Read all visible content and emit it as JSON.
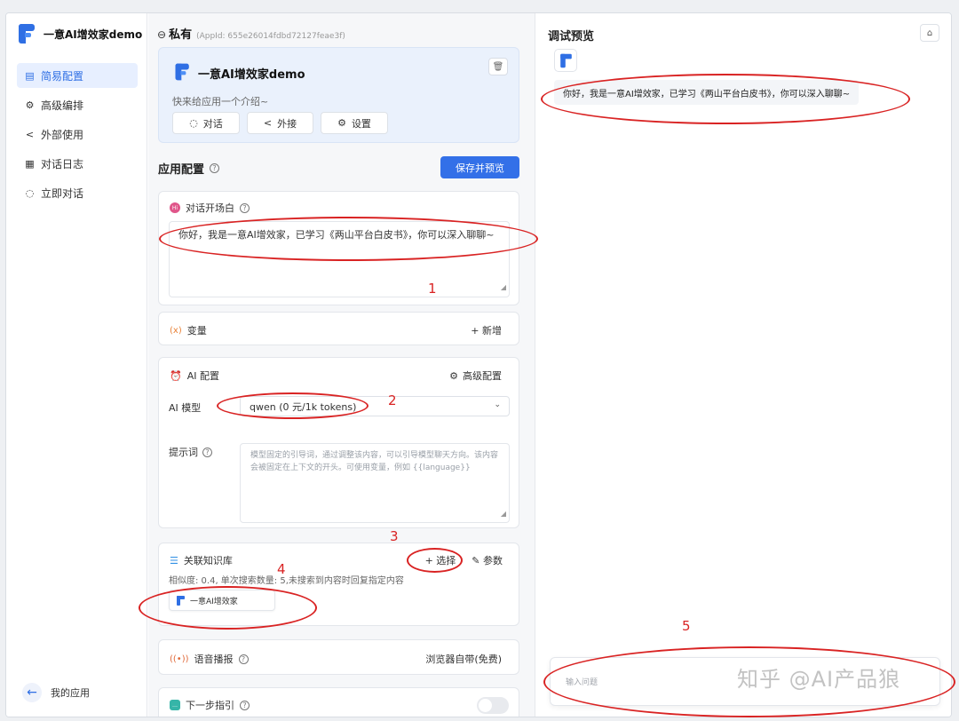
{
  "brand": {
    "name": "一意AI增效家demo"
  },
  "sidebar": {
    "items": [
      {
        "label": "简易配置",
        "icon": "grid-icon",
        "active": true
      },
      {
        "label": "高级编排",
        "icon": "gear-icon",
        "active": false
      },
      {
        "label": "外部使用",
        "icon": "share-icon",
        "active": false
      },
      {
        "label": "对话日志",
        "icon": "log-icon",
        "active": false
      },
      {
        "label": "立即对话",
        "icon": "chat-icon",
        "active": false
      }
    ],
    "back_label": "我的应用"
  },
  "header": {
    "privacy": "私有",
    "app_id": "(AppId: 655e26014fdbd72127feae3f)"
  },
  "app_card": {
    "name": "一意AI增效家demo",
    "desc": "快来给应用一个介绍~",
    "buttons": [
      "对话",
      "外接",
      "设置"
    ]
  },
  "config": {
    "title": "应用配置",
    "save_label": "保存并预览",
    "opening": {
      "title": "对话开场白",
      "text": "你好，我是一意AI增效家，已学习《两山平台白皮书》，你可以深入聊聊~"
    },
    "variables": {
      "title": "变量",
      "add_label": "+ 新增"
    },
    "ai": {
      "title": "AI 配置",
      "advanced_label": "高级配置",
      "model_label": "AI 模型",
      "model_value": "qwen (0 元/1k tokens)",
      "prompt_label": "提示词",
      "prompt_placeholder": "模型固定的引导词，通过调整该内容，可以引导模型聊天方向。该内容会被固定在上下文的开头。可使用变量，例如 {{language}}"
    },
    "kb": {
      "title": "关联知识库",
      "select_label": "+ 选择",
      "params_label": "参数",
      "meta": "相似度: 0.4, 单次搜索数量: 5,未搜索到内容时回复指定内容",
      "chip": "一意AI增效家"
    },
    "voice": {
      "title": "语音播报",
      "value": "浏览器自带(免费)"
    },
    "next": {
      "title": "下一步指引"
    }
  },
  "preview": {
    "title": "调试预览",
    "message": "你好，我是一意AI增效家，已学习《两山平台白皮书》，你可以深入聊聊~",
    "input_placeholder": "输入问题"
  },
  "annotations": [
    "1",
    "2",
    "3",
    "4",
    "5"
  ],
  "watermark": "知乎 @AI产品狼",
  "colors": {
    "accent": "#3370e8",
    "annotation": "#d92323"
  }
}
